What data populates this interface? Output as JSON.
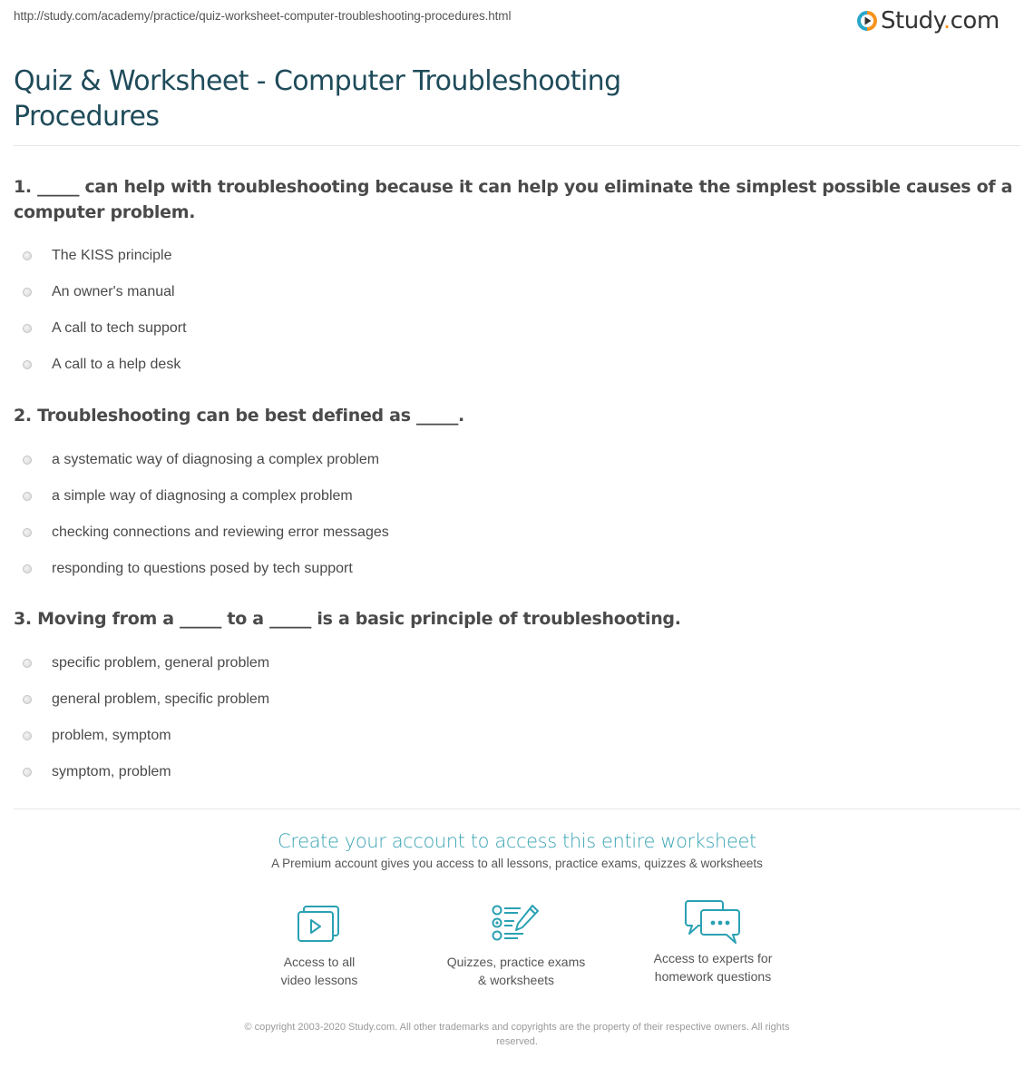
{
  "header": {
    "url": "http://study.com/academy/practice/quiz-worksheet-computer-troubleshooting-procedures.html",
    "logo": {
      "word": "Study",
      "dot": ".",
      "tld": "com",
      "icon": "play-circle-logo-icon",
      "colors": {
        "ring_blue": "#2aa6c8",
        "ring_orange": "#f7941d",
        "play": "#333333"
      }
    },
    "title": "Quiz & Worksheet - Computer Troubleshooting Procedures"
  },
  "questions": [
    {
      "text": "1. _____ can help with troubleshooting because it can help you eliminate the simplest possible causes of a computer problem.",
      "options": [
        "The KISS principle",
        "An owner's manual",
        "A call to tech support",
        "A call to a help desk"
      ]
    },
    {
      "text": "2. Troubleshooting can be best defined as _____.",
      "options": [
        "a systematic way of diagnosing a complex problem",
        "a simple way of diagnosing a complex problem",
        "checking connections and reviewing error messages",
        "responding to questions posed by tech support"
      ]
    },
    {
      "text": "3. Moving from a _____ to a _____ is a basic principle of troubleshooting.",
      "options": [
        "specific problem, general problem",
        "general problem, specific problem",
        "problem, symptom",
        "symptom, problem"
      ]
    }
  ],
  "cta": {
    "title": "Create your account to access this entire worksheet",
    "subtitle": "A Premium account gives you access to all lessons, practice exams, quizzes & worksheets",
    "accent": "#3aa4b4",
    "features": [
      {
        "icon": "video-lessons-icon",
        "line1": "Access to all",
        "line2": "video lessons"
      },
      {
        "icon": "quiz-checklist-pencil-icon",
        "line1": "Quizzes, practice exams",
        "line2": "& worksheets"
      },
      {
        "icon": "chat-bubbles-icon",
        "line1": "Access to experts for",
        "line2": "homework questions"
      }
    ]
  },
  "footer": {
    "copyright_line1": "© copyright 2003-2020 Study.com. All other trademarks and copyrights are the property of their respective owners. All rights",
    "copyright_line2": "reserved."
  }
}
